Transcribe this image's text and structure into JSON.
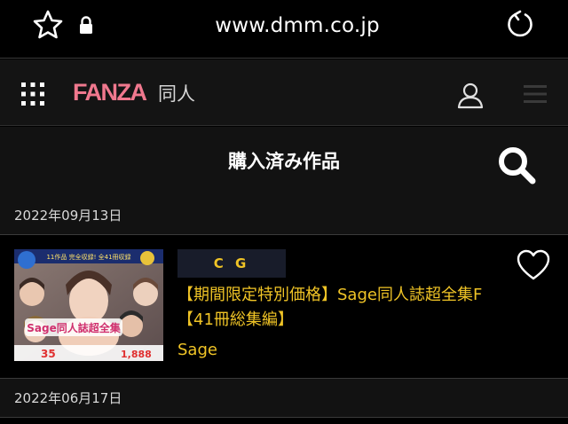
{
  "browser": {
    "url": "www.dmm.co.jp",
    "icons": {
      "bookmark": "star-icon",
      "secure": "lock-icon",
      "reload": "reload-icon"
    }
  },
  "site": {
    "logo_text": "FANZA",
    "section_label": "同人",
    "logo_color": "#f0788e",
    "icons": {
      "apps": "grid-icon",
      "account": "user-icon",
      "menu": "menu-icon"
    }
  },
  "page": {
    "title": "購入済み作品",
    "search_icon": "search-icon"
  },
  "purchases": [
    {
      "date": "2022年09月13日",
      "category": "C G",
      "title": "【期間限定特別価格】Sage同人誌超全集F【41冊総集編】",
      "author": "Sage",
      "favorite_icon": "heart-icon",
      "thumbnail": {
        "banner_top": "11作品 完全収録! 全41冊収録",
        "logo_text": "Sage同人誌超全集",
        "footer_left": "35",
        "footer_right": "1,888"
      }
    },
    {
      "date": "2022年06月17日"
    }
  ],
  "colors": {
    "accent_yellow": "#f0c426",
    "background": "#000000",
    "panel": "#141414"
  }
}
